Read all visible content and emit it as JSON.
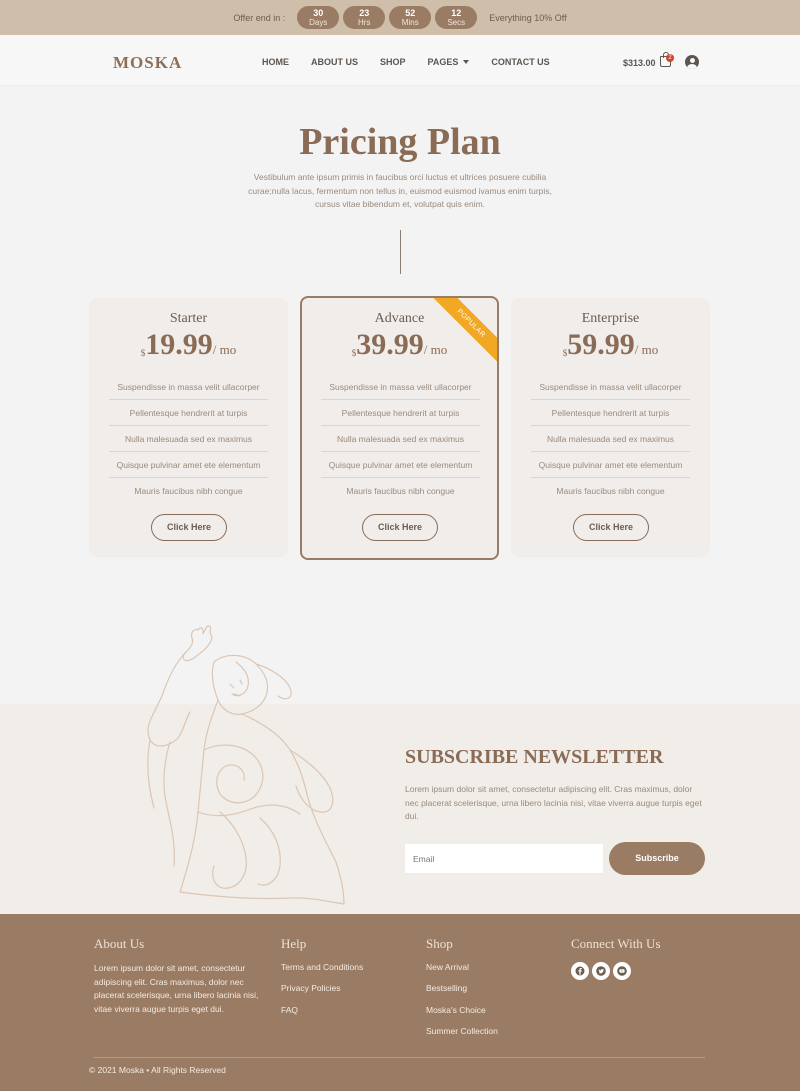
{
  "topbar": {
    "offer_label": "Offer end in :",
    "timers": [
      {
        "value": "30",
        "unit": "Days"
      },
      {
        "value": "23",
        "unit": "Hrs"
      },
      {
        "value": "52",
        "unit": "Mins"
      },
      {
        "value": "12",
        "unit": "Secs"
      }
    ],
    "deal_text": "Everything 10% Off"
  },
  "header": {
    "logo": "MOSKA",
    "nav": [
      "HOME",
      "ABOUT US",
      "SHOP",
      "PAGES",
      "CONTACT US"
    ],
    "cart_total": "$313.00",
    "cart_count": "2"
  },
  "pricing": {
    "title": "Pricing Plan",
    "description": "Vestibulum ante ipsum primis in faucibus orci luctus et ultrices posuere cubilia curae;nulla lacus, fermentum non tellus in, euismod euismod ivamus enim turpis, cursus vitae bibendum et, volutpat quis enim.",
    "plans": [
      {
        "name": "Starter",
        "currency": "$",
        "amount": "19.99",
        "period": "/ mo",
        "features": [
          "Suspendisse in massa velit ullacorper",
          "Pellentesque hendrerit at turpis",
          "Nulla malesuada sed ex maximus",
          "Quisque pulvinar amet ete elementum",
          "Mauris faucibus nibh congue"
        ],
        "cta": "Click Here"
      },
      {
        "name": "Advance",
        "currency": "$",
        "amount": "39.99",
        "period": "/ mo",
        "badge": "POPULAR",
        "features": [
          "Suspendisse in massa velit ullacorper",
          "Pellentesque hendrerit at turpis",
          "Nulla malesuada sed ex maximus",
          "Quisque pulvinar amet ete elementum",
          "Mauris faucibus nibh congue"
        ],
        "cta": "Click Here"
      },
      {
        "name": "Enterprise",
        "currency": "$",
        "amount": "59.99",
        "period": "/ mo",
        "features": [
          "Suspendisse in massa velit ullacorper",
          "Pellentesque hendrerit at turpis",
          "Nulla malesuada sed ex maximus",
          "Quisque pulvinar amet ete elementum",
          "Mauris faucibus nibh congue"
        ],
        "cta": "Click Here"
      }
    ]
  },
  "newsletter": {
    "title": "SUBSCRIBE NEWSLETTER",
    "description": "Lorem ipsum dolor sit amet, consectetur adipiscing elit. Cras maximus, dolor nec placerat scelerisque, urna libero lacinia nisi, vitae viverra augue turpis eget dui.",
    "email_placeholder": "Email",
    "button": "Subscribe"
  },
  "footer": {
    "about": {
      "title": "About Us",
      "text": "Lorem ipsum dolor sit amet, consectetur adipiscing elit. Cras maximus, dolor nec placerat scelerisque, urna libero lacinia nisi, vitae viverra augue turpis eget dui."
    },
    "help": {
      "title": "Help",
      "links": [
        "Terms and Conditions",
        "Privacy Policies",
        "FAQ"
      ]
    },
    "shop": {
      "title": "Shop",
      "links": [
        "New Arrival",
        "Bestselling",
        "Moska's Choice",
        "Summer Collection"
      ]
    },
    "connect": {
      "title": "Connect With Us",
      "icons": [
        "facebook-icon",
        "twitter-icon",
        "youtube-icon"
      ]
    },
    "copyright": "© 2021 Moska • All Rights Reserved"
  },
  "colors": {
    "brand": "#9a7b63",
    "topbar": "#cfbfaa",
    "badge": "#f2a823",
    "cart_badge": "#d0432f"
  }
}
